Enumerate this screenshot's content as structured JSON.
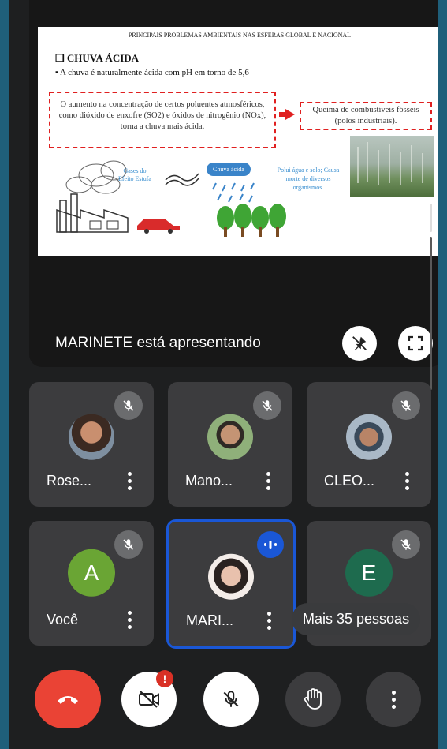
{
  "slide": {
    "title": "PRINCIPAIS PROBLEMAS AMBIENTAIS NAS ESFERAS GLOBAL E NACIONAL",
    "heading": "❑ CHUVA ÁCIDA",
    "bullet": "▪ A chuva é naturalmente ácida com pH em torno de 5,6",
    "box_left": "O aumento na concentração de certos poluentes atmosféricos, como dióxido de enxofre (SO2) e óxidos de nitrogênio (NOx), torna a chuva mais ácida.",
    "box_right": "Queima de combustíveis fósseis (polos industriais).",
    "gases_label": "Gases do Efeito Estufa",
    "chuva_label": "Chuva ácida",
    "polui_label": "Polui água e solo; Causa morte de diversos organismos."
  },
  "presenter": {
    "text": "MARINETE está apresentando"
  },
  "participants": [
    {
      "name": "Rose...",
      "type": "photo",
      "muted": true
    },
    {
      "name": "Mano...",
      "type": "photo",
      "muted": true
    },
    {
      "name": "CLEO...",
      "type": "photo",
      "muted": true
    },
    {
      "name": "Você",
      "type": "letter",
      "letter": "A",
      "color": "#6aa534",
      "muted": true
    },
    {
      "name": "MARI...",
      "type": "photo",
      "muted": false,
      "speaking": true
    },
    {
      "name": "",
      "type": "letter",
      "letter": "E",
      "color": "#1e6b4e",
      "muted": true
    }
  ],
  "tooltip": "Mais 35 pessoas",
  "controls": {
    "notification_badge": "!",
    "icons": [
      "end-call-icon",
      "camera-off-icon",
      "mic-off-icon",
      "raise-hand-icon",
      "more-options-icon"
    ]
  },
  "colors": {
    "end_call": "#ea4335",
    "speaking": "#1a57d6",
    "tile_bg": "#3c3c3e"
  }
}
